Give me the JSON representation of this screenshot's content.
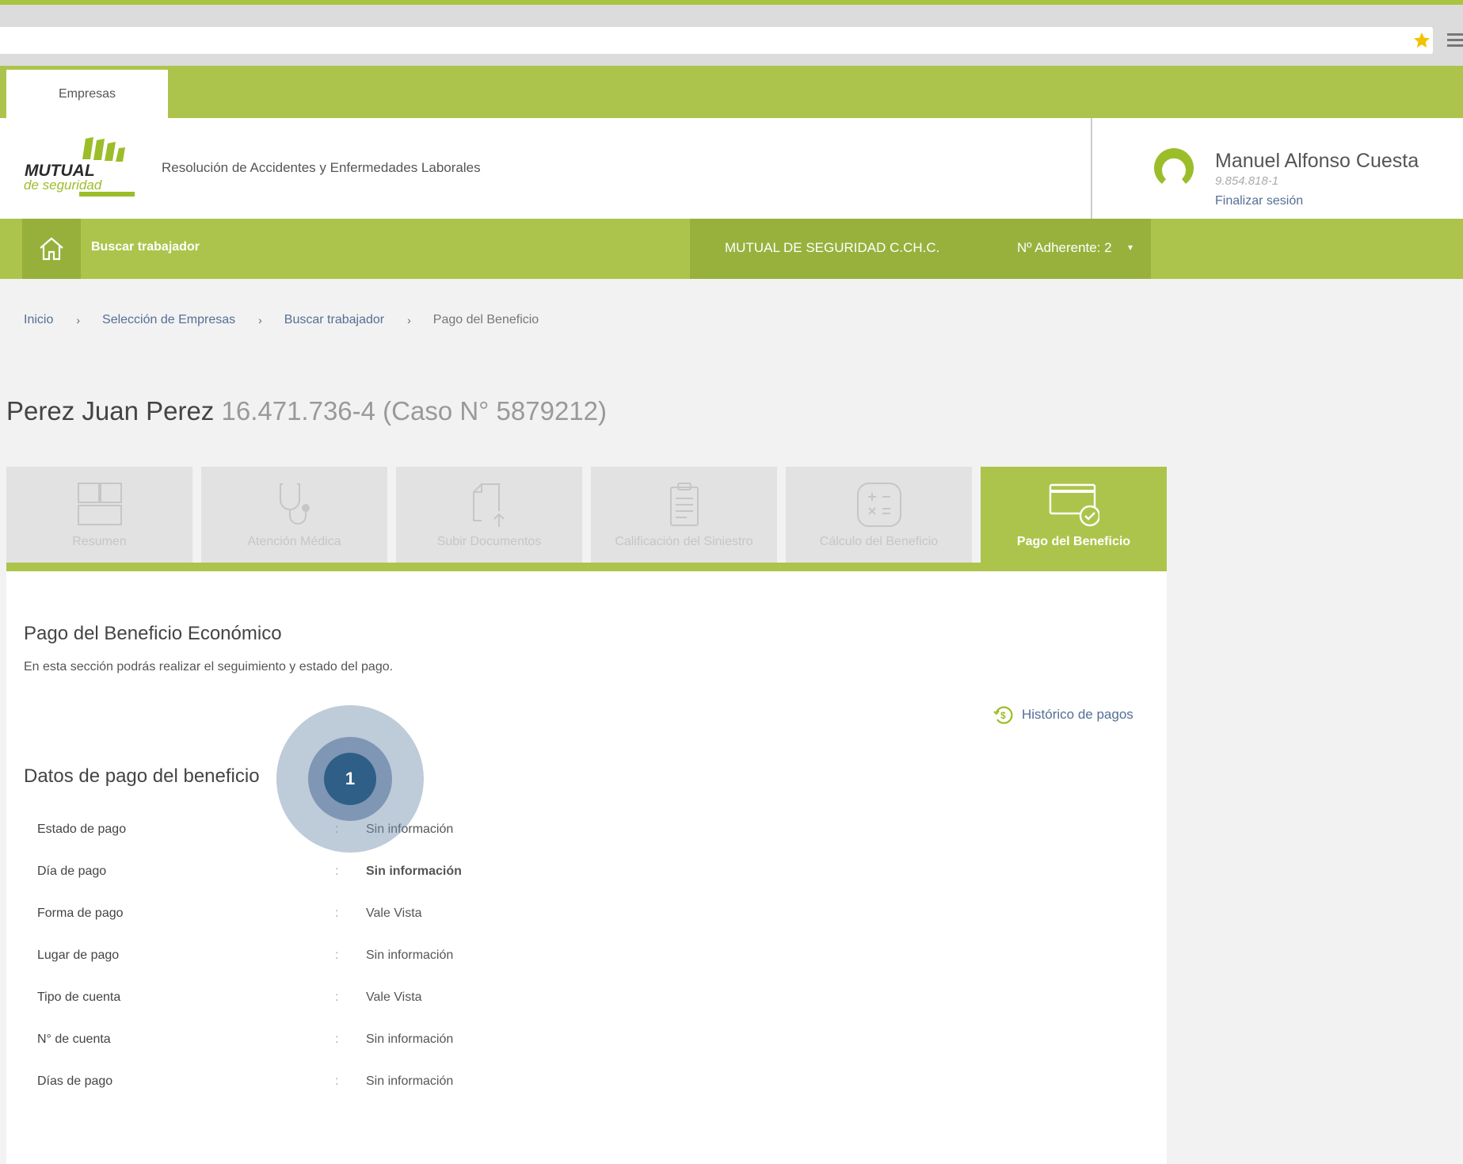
{
  "browser": {
    "star_icon": "star-icon",
    "menu_icon": "hamburger-menu-icon"
  },
  "tabs_top": {
    "empresas": "Empresas"
  },
  "header": {
    "logo_icon": "mutual-de-seguridad-logo",
    "logo_brand": "MUTUAL",
    "logo_sub": "de seguridad",
    "app_title": "Resolución de Accidentes y Enfermedades Laborales",
    "user_name": "Manuel Alfonso Cuesta",
    "user_rut": "9.854.818-1",
    "logout": "Finalizar sesión"
  },
  "navbar": {
    "home_icon": "home-icon",
    "search_worker": "Buscar trabajador",
    "company": "MUTUAL DE SEGURIDAD C.CH.C.",
    "adherente": "Nº Adherente: 2",
    "caret": "▾"
  },
  "breadcrumb": {
    "items": [
      "Inicio",
      "Selección de Empresas",
      "Buscar trabajador"
    ],
    "current": "Pago del Beneficio",
    "separator": "›"
  },
  "worker": {
    "name": "Perez Juan Perez",
    "details": "16.471.736-4 (Caso N° 5879212)"
  },
  "steps": [
    {
      "label": "Resumen",
      "icon": "grid-layout-icon"
    },
    {
      "label": "Atención Médica",
      "icon": "stethoscope-icon"
    },
    {
      "label": "Subir Documentos",
      "icon": "document-upload-icon"
    },
    {
      "label": "Calificación del Siniestro",
      "icon": "clipboard-icon"
    },
    {
      "label": "Cálculo del Beneficio",
      "icon": "calculator-icon"
    },
    {
      "label": "Pago del Beneficio",
      "icon": "card-payment-icon"
    }
  ],
  "payment": {
    "title": "Pago del Beneficio Económico",
    "description": "En esta sección podrás realizar el seguimiento y estado del pago.",
    "history_link": "Histórico de pagos",
    "history_icon": "dollar-history-icon",
    "data_title": "Datos de pago del beneficio",
    "colon": ":",
    "rows": [
      {
        "key": "Estado de pago",
        "value": "Sin información"
      },
      {
        "key": "Día de pago",
        "value": "Sin información"
      },
      {
        "key": "Forma de pago",
        "value": "Vale Vista"
      },
      {
        "key": "Lugar de pago",
        "value": "Sin información"
      },
      {
        "key": "Tipo de cuenta",
        "value": "Vale Vista"
      },
      {
        "key": "N° de cuenta",
        "value": "Sin información"
      },
      {
        "key": "Días de pago",
        "value": "Sin información"
      }
    ]
  },
  "hotspot": {
    "label": "1"
  },
  "colors": {
    "accent_green": "#adc44c",
    "nav_green_dark": "#98b13d",
    "link_blue": "#556f95",
    "hotspot": "#2f5f86"
  }
}
